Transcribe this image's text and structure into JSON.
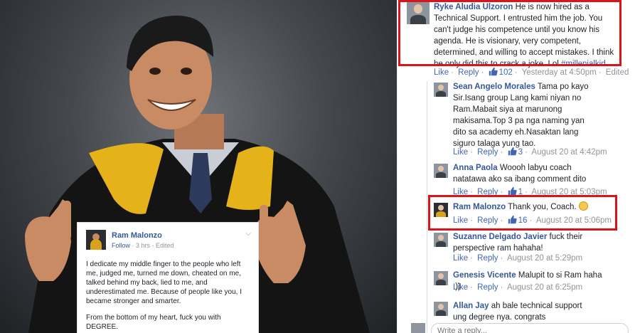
{
  "post": {
    "author": "Ram Malonzo",
    "follow": "Follow",
    "time": "3 hrs",
    "edited": "Edited",
    "paragraph1": "I dedicate my middle finger to the people who left me, judged me, turned me down, cheated on me, talked behind my back, lied to me, and underestimated me. Because of people like you, I became stronger and smarter.",
    "paragraph2": "From the bottom of my heart, fuck you with DEGREE."
  },
  "comments": [
    {
      "author": "Ryke Aludia Ulzoron",
      "text": "He is now hired as a Technical Support. I entrusted him the job. You can't judge his competence until you know his agenda. He is visionary, very competent, determined, and willing to accept mistakes. I think he only did this to crack a joke. Lol",
      "hashtag": "#millenialkid",
      "like": "Like",
      "reply": "Reply",
      "likes": "102",
      "time": "Yesterday at 4:50pm",
      "edited": "Edited"
    },
    {
      "author": "Sean Angelo Morales",
      "text": "Tama po kayo Sir.Isang group Lang kami niyan no Ram.Mabait siya at marunong makisama.Top 3 pa nga naming yan dito sa academy eh.Nasaktan lang siguro talaga yung tao.",
      "like": "Like",
      "reply": "Reply",
      "likes": "3",
      "time": "August 20 at 4:42pm"
    },
    {
      "author": "Anna Paola",
      "text": "Woooh labyu coach natatawa ako sa ibang comment dito",
      "like": "Like",
      "reply": "Reply",
      "likes": "1",
      "time": "August 20 at 5:03pm"
    },
    {
      "author": "Ram Malonzo",
      "text": "Thank you, Coach.",
      "like": "Like",
      "reply": "Reply",
      "likes": "16",
      "time": "August 20 at 5:06pm"
    },
    {
      "author": "Suzanne Delgado Javier",
      "text": "fuck their perspective ram hahaha!",
      "like": "Like",
      "reply": "Reply",
      "time": "August 20 at 5:29pm"
    },
    {
      "author": "Genesis Vicente",
      "text": "Malupit to si Ram haha :))",
      "like": "Like",
      "reply": "Reply",
      "time": "August 20 at 6:25pm"
    },
    {
      "author": "Allan Jay",
      "text": "ah bale technical support ung degree nya. congrats"
    }
  ],
  "reply_box": {
    "placeholder": "Write a reply..."
  },
  "colors": {
    "highlight": "#d9141b",
    "link": "#365899",
    "action": "#4267b2",
    "meta": "#90949c"
  }
}
